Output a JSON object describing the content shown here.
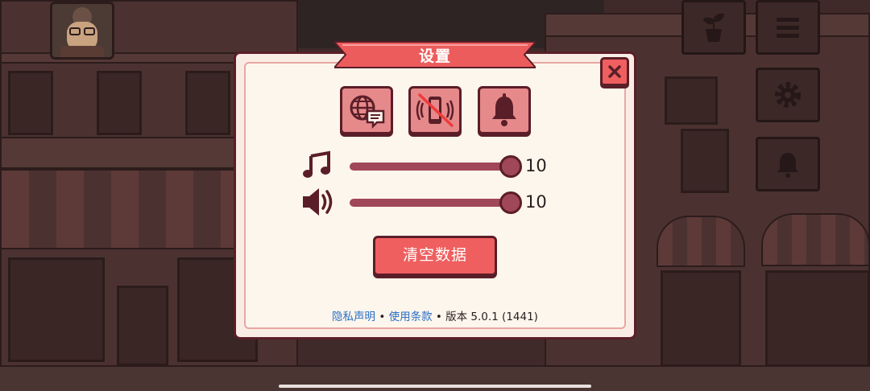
{
  "dialog": {
    "title": "设置",
    "close_symbol": "✕",
    "icons": [
      "language-icon",
      "vibration-off-icon",
      "notification-bell-icon"
    ],
    "music": {
      "icon": "music-note-icon",
      "value": "10",
      "level": 1.0
    },
    "sound": {
      "icon": "speaker-icon",
      "value": "10",
      "level": 1.0
    },
    "clear_data_label": "清空数据",
    "footer": {
      "privacy": "隐私声明",
      "sep1": " • ",
      "terms": "使用条款",
      "sep2": " • ",
      "version": "版本  5.0.1 (1441)"
    }
  },
  "background": {
    "side_buttons": [
      "plant-icon",
      "menu-icon",
      "gear-icon",
      "bell-icon"
    ]
  },
  "colors": {
    "accent": "#ef5f5f",
    "ribbon": "#ec5c5c",
    "dialog_border": "#5a1e28",
    "slider": "#a04759",
    "panel": "#fdf6ec",
    "link": "#2c6ec6"
  }
}
